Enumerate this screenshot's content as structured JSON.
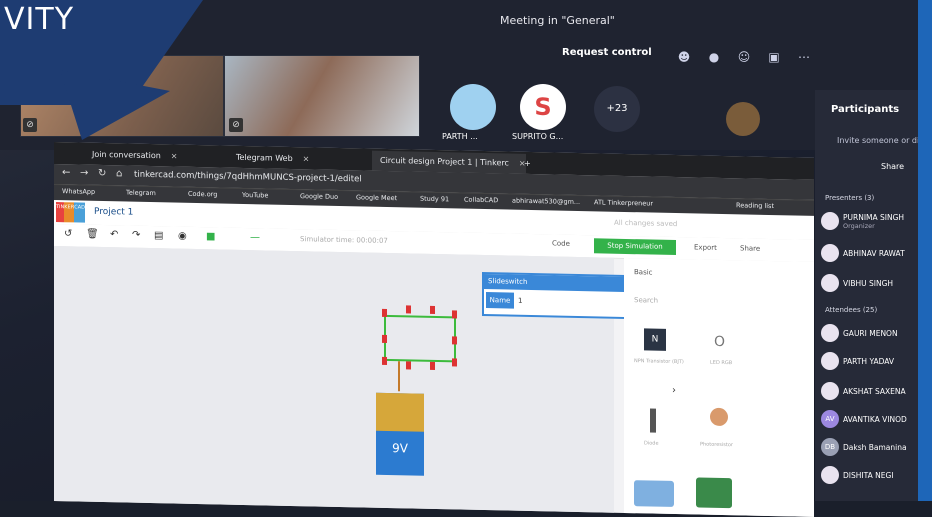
{
  "banner": {
    "text": "VITY"
  },
  "teams": {
    "meeting_title": "Meeting in \"General\"",
    "request_control": "Request control",
    "participant_count": "+23",
    "presenters": [
      {
        "name": "PARTH ...",
        "avatar": ""
      },
      {
        "name": "SUPRITO G...",
        "avatar": "S"
      }
    ]
  },
  "panel": {
    "title": "Participants",
    "invite": "Invite someone or dia",
    "share": "Share",
    "presenters_header": "Presenters (3)",
    "attendees_header": "Attendees (25)",
    "presenters": [
      {
        "name": "PURNIMA SINGH",
        "sub": "Organizer",
        "initials": ""
      },
      {
        "name": "ABHINAV RAWAT",
        "sub": "",
        "initials": ""
      },
      {
        "name": "VIBHU SINGH",
        "sub": "",
        "initials": ""
      }
    ],
    "attendees": [
      {
        "name": "GAURI MENON",
        "initials": ""
      },
      {
        "name": "PARTH YADAV",
        "initials": ""
      },
      {
        "name": "AKSHAT SAXENA",
        "initials": ""
      },
      {
        "name": "AVANTIKA VINOD",
        "initials": "AV"
      },
      {
        "name": "Daksh Bamanina",
        "initials": "DB"
      },
      {
        "name": "DISHITA NEGI",
        "initials": ""
      }
    ]
  },
  "browser": {
    "tabs": [
      {
        "label": "Join conversation"
      },
      {
        "label": "Telegram Web"
      },
      {
        "label": "Circuit design Project 1 | Tinkerc"
      }
    ],
    "url": "tinkercad.com/things/7qdHhmMUNCS-project-1/editel",
    "bookmarks": [
      "WhatsApp",
      "Telegram",
      "Code.org",
      "YouTube",
      "Google Duo",
      "Google Meet",
      "Study 91",
      "CollabCAD",
      "abhirawat530@gm...",
      "ATL Tinkerpreneur",
      "Reading list"
    ]
  },
  "tinkercad": {
    "project_title": "Project 1",
    "logo_letters": [
      "TIN",
      "KER",
      "CAD"
    ],
    "saved_status": "All changes saved",
    "simulator_time": "Simulator time: 00:00:07",
    "code_label": "Code",
    "stop_label": "Stop Simulation",
    "export_label": "Export",
    "share_label": "Share",
    "slideswitch_title": "Slideswitch",
    "name_label": "Name",
    "name_value": "1",
    "components_select": "Basic",
    "search_placeholder": "Search",
    "battery_label": "9V",
    "components": [
      "NPN Transistor (BJT)",
      "LED RGB",
      "Diode",
      "Photoresistor"
    ]
  }
}
